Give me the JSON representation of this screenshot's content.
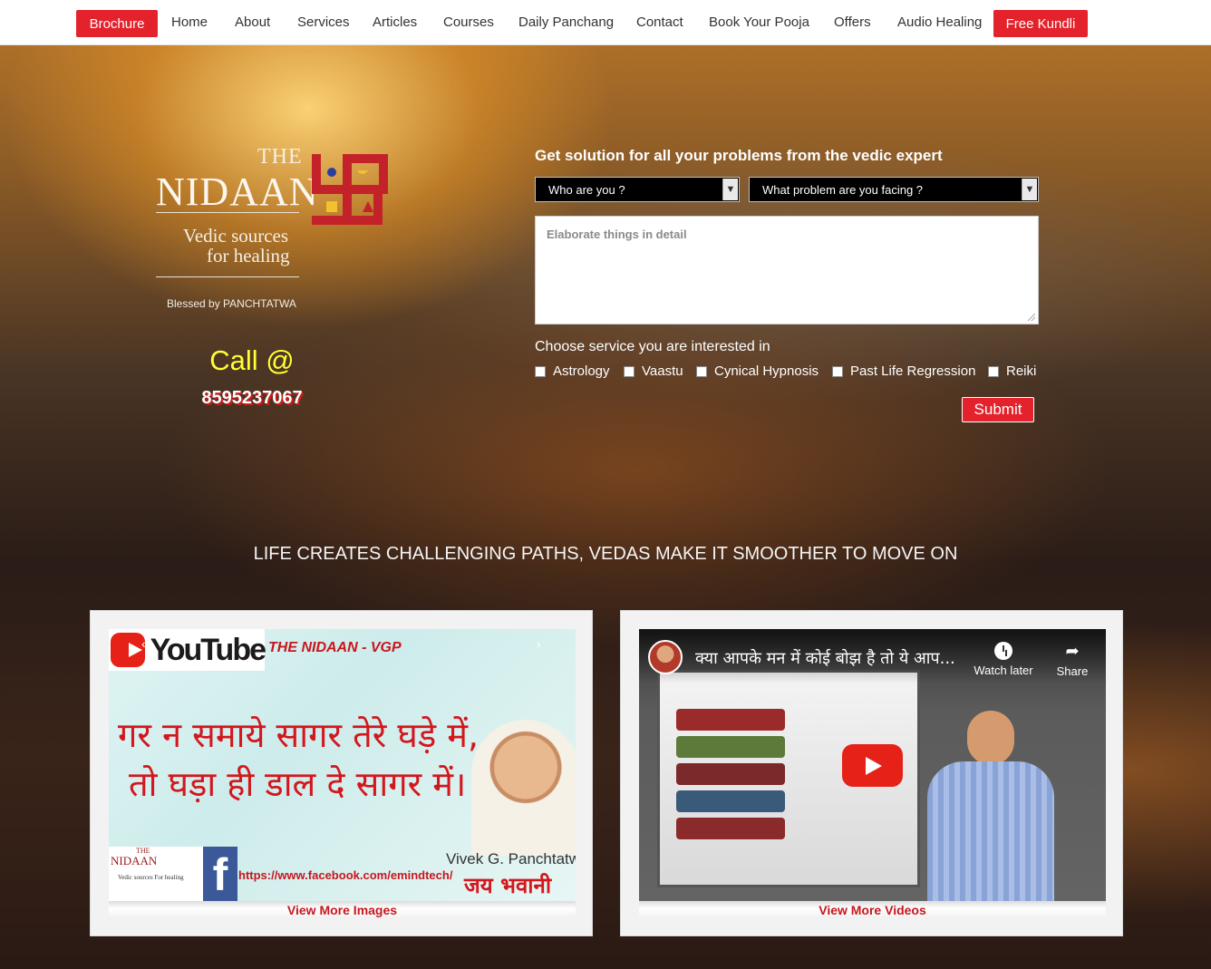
{
  "nav": {
    "brochure": "Brochure",
    "links": [
      "Home",
      "About",
      "Services",
      "Articles",
      "Courses",
      "Daily Panchang",
      "Contact",
      "Book Your Pooja",
      "Offers",
      "Audio Healing"
    ],
    "free_kundli": "Free Kundli"
  },
  "logo": {
    "the": "THE",
    "name": "NIDAAN",
    "tagline1": "Vedic sources",
    "tagline2": "for healing",
    "blessed": "Blessed by PANCHTATWA"
  },
  "call": {
    "label": "Call @",
    "number": "8595237067"
  },
  "form": {
    "title": "Get solution for all your problems from the vedic expert",
    "who_select": "Who are you ?",
    "problem_select": "What problem are you facing ?",
    "detail_placeholder": "Elaborate things in detail",
    "service_heading": "Choose service you are interested in",
    "services": [
      "Astrology",
      "Vaastu",
      "Cynical Hypnosis",
      "Past Life Regression",
      "Reiki"
    ],
    "submit": "Submit"
  },
  "tagline": "LIFE CREATES CHALLENGING PATHS, VEDAS MAKE IT SMOOTHER TO MOVE ON",
  "image_card": {
    "yt_word": "YouTube",
    "channel": "THE NIDAAN - VGP",
    "hindi_line1": "गर न समाये सागर तेरे घड़े में,",
    "hindi_line2": "तो घड़ा ही डाल दे सागर में।",
    "fb_url": "https://www.facebook.com/emindtech/",
    "person_name": "Vivek G. Panchtatwa",
    "jai": "जय भवानी",
    "mini_the": "THE",
    "mini_name": "NIDAAN",
    "mini_tag": "Vedic sources For healing",
    "fb_letter": "f",
    "prev_arrow": "‹",
    "next_arrow": "›",
    "link": "View More Images"
  },
  "video_card": {
    "title": "क्या आपके मन में कोई बोझ है तो ये आप...",
    "watch_later": "Watch later",
    "share": "Share",
    "link": "View More Videos"
  },
  "colors": {
    "accent_red": "#e3222c",
    "call_yellow": "#ffff33",
    "link_red": "#c8161e"
  }
}
